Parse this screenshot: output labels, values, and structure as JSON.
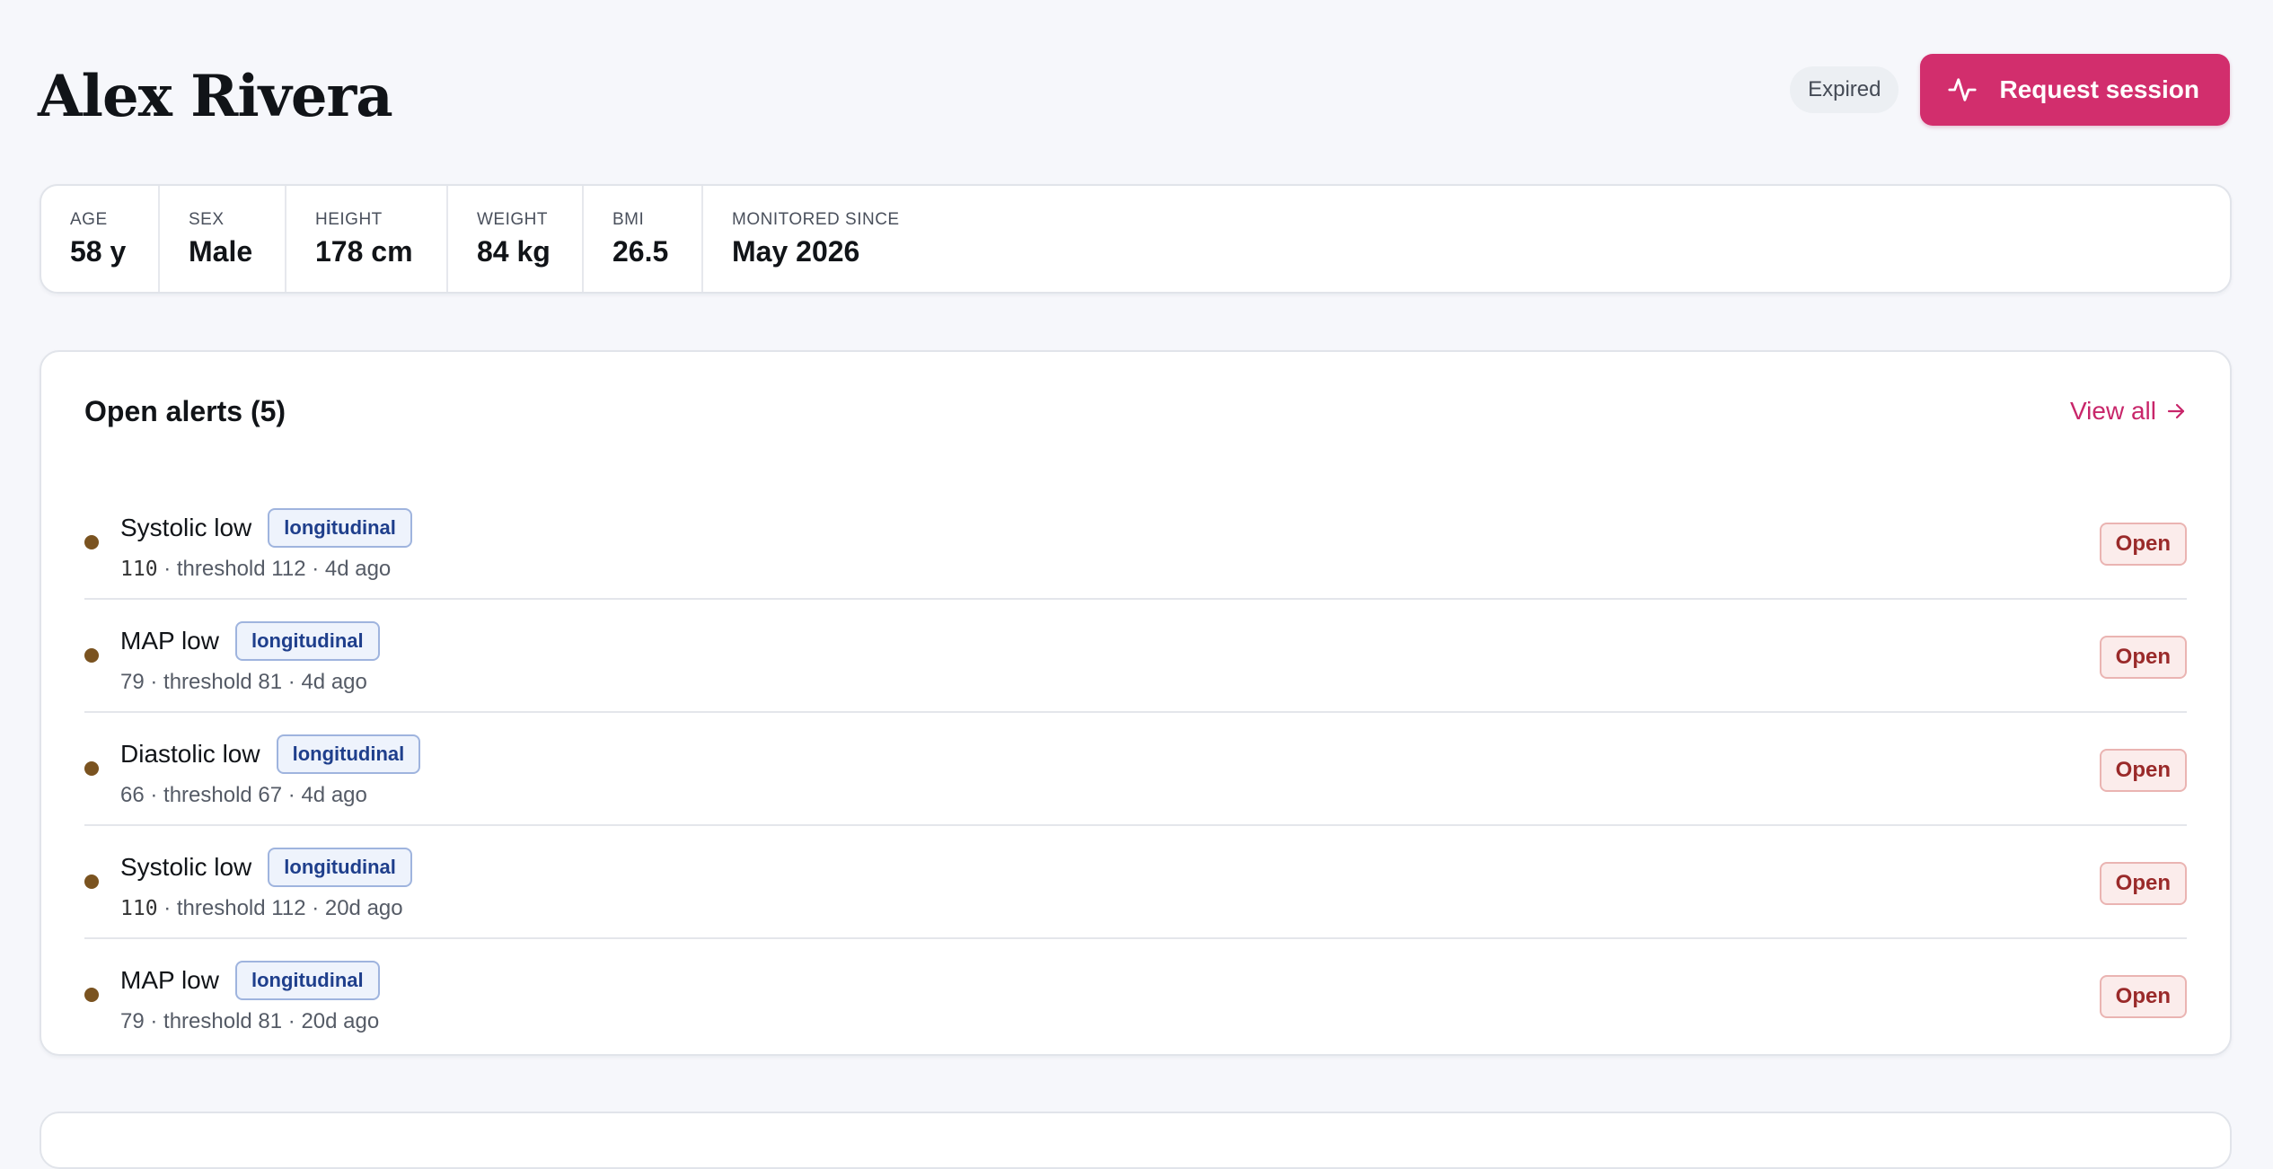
{
  "header": {
    "patient_name": "Alex Rivera",
    "status": "Expired",
    "request_label": "Request session"
  },
  "stats": [
    {
      "label": "AGE",
      "value": "58 y"
    },
    {
      "label": "SEX",
      "value": "Male"
    },
    {
      "label": "HEIGHT",
      "value": "178 cm"
    },
    {
      "label": "WEIGHT",
      "value": "84 kg"
    },
    {
      "label": "BMI",
      "value": "26.5"
    },
    {
      "label": "MONITORED SINCE",
      "value": "May 2026"
    }
  ],
  "alerts": {
    "title": "Open alerts (5)",
    "view_all": "View all",
    "items": [
      {
        "name": "Systolic low",
        "tag": "longitudinal",
        "value": "110",
        "detail": " · threshold 112 · 4d ago",
        "status": "Open"
      },
      {
        "name": "MAP low",
        "tag": "longitudinal",
        "value": "79",
        "detail": " · threshold 81 · 4d ago",
        "status": "Open"
      },
      {
        "name": "Diastolic low",
        "tag": "longitudinal",
        "value": "66",
        "detail": " · threshold 67 · 4d ago",
        "status": "Open"
      },
      {
        "name": "Systolic low",
        "tag": "longitudinal",
        "value": "110",
        "detail": " · threshold 112 · 20d ago",
        "status": "Open"
      },
      {
        "name": "MAP low",
        "tag": "longitudinal",
        "value": "79",
        "detail": " · threshold 81 · 20d ago",
        "status": "Open"
      }
    ]
  },
  "icons": {
    "request": "activity-pulse-icon",
    "view_all": "arrow-right-icon",
    "alert_dot": "status-dot-icon"
  },
  "colors": {
    "accent": "#d22e6d",
    "link": "#c8266a",
    "tag_text": "#1f3f8c",
    "open_text": "#9a2a2a",
    "dot": "#7a5320"
  }
}
